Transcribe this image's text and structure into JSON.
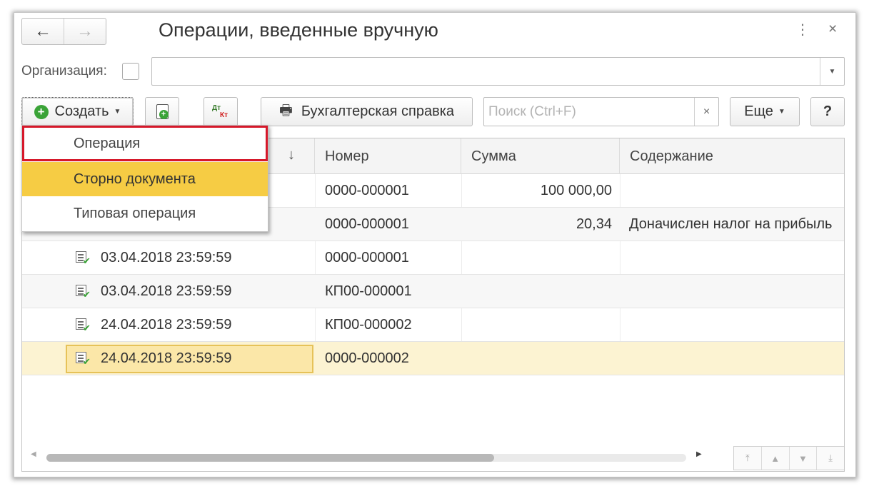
{
  "window": {
    "title": "Операции, введенные вручную",
    "nav": {
      "back_icon": "←",
      "forward_icon": "→"
    },
    "menu_icon": "⋮",
    "close_icon": "×"
  },
  "filter": {
    "organization_label": "Организация:",
    "organization_value": ""
  },
  "toolbar": {
    "create_label": "Создать",
    "report_label": "Бухгалтерская справка",
    "search_placeholder": "Поиск (Ctrl+F)",
    "search_clear": "×",
    "more_label": "Еще",
    "help_label": "?",
    "dtkt": {
      "dt": "Дт",
      "kt": "Кт"
    }
  },
  "dropdown": {
    "items": [
      {
        "label": "Операция"
      },
      {
        "label": "Сторно документа"
      },
      {
        "label": "Типовая операция"
      }
    ]
  },
  "table": {
    "sort_indicator": "↓",
    "columns": [
      "Номер",
      "Сумма",
      "Содержание"
    ],
    "rows": [
      {
        "date": "",
        "number": "0000-000001",
        "sum": "100 000,00",
        "content": ""
      },
      {
        "date": "",
        "number": "0000-000001",
        "sum": "20,34",
        "content": "Доначислен налог на прибыль"
      },
      {
        "date": "03.04.2018 23:59:59",
        "number": "0000-000001",
        "sum": "",
        "content": ""
      },
      {
        "date": "03.04.2018 23:59:59",
        "number": "КП00-000001",
        "sum": "",
        "content": ""
      },
      {
        "date": "24.04.2018 23:59:59",
        "number": "КП00-000002",
        "sum": "",
        "content": ""
      },
      {
        "date": "24.04.2018 23:59:59",
        "number": "0000-000002",
        "sum": "",
        "content": ""
      }
    ]
  },
  "colors": {
    "accent_green": "#3aa337",
    "highlight_yellow": "#f6cc44",
    "selected_row": "#fcf3d2",
    "focus_red": "#d6182a"
  }
}
